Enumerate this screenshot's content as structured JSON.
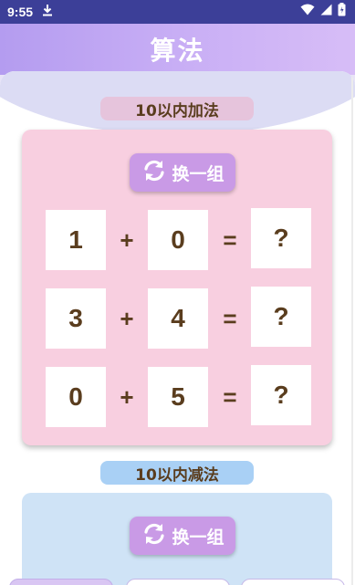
{
  "status_bar": {
    "time": "9:55"
  },
  "header": {
    "title": "算法"
  },
  "addition": {
    "label": "10以内加法",
    "swap_label": "换一组",
    "rows": [
      {
        "a": "1",
        "op": "+",
        "b": "0",
        "eq": "=",
        "result": "?"
      },
      {
        "a": "3",
        "op": "+",
        "b": "4",
        "eq": "=",
        "result": "?"
      },
      {
        "a": "0",
        "op": "+",
        "b": "5",
        "eq": "=",
        "result": "?"
      }
    ]
  },
  "subtraction": {
    "label": "10以内减法",
    "swap_label": "换一组"
  },
  "colors": {
    "header_gradient_start": "#b49cf0",
    "addition_panel": "#f8cfe0",
    "subtraction_panel": "#cfe3f6",
    "swap_button": "#c99ae6",
    "text_brown": "#5a3d1e"
  },
  "icons": {
    "status": [
      "download-icon",
      "wifi-icon",
      "signal-icon",
      "battery-icon"
    ],
    "swap": "refresh-icon"
  }
}
